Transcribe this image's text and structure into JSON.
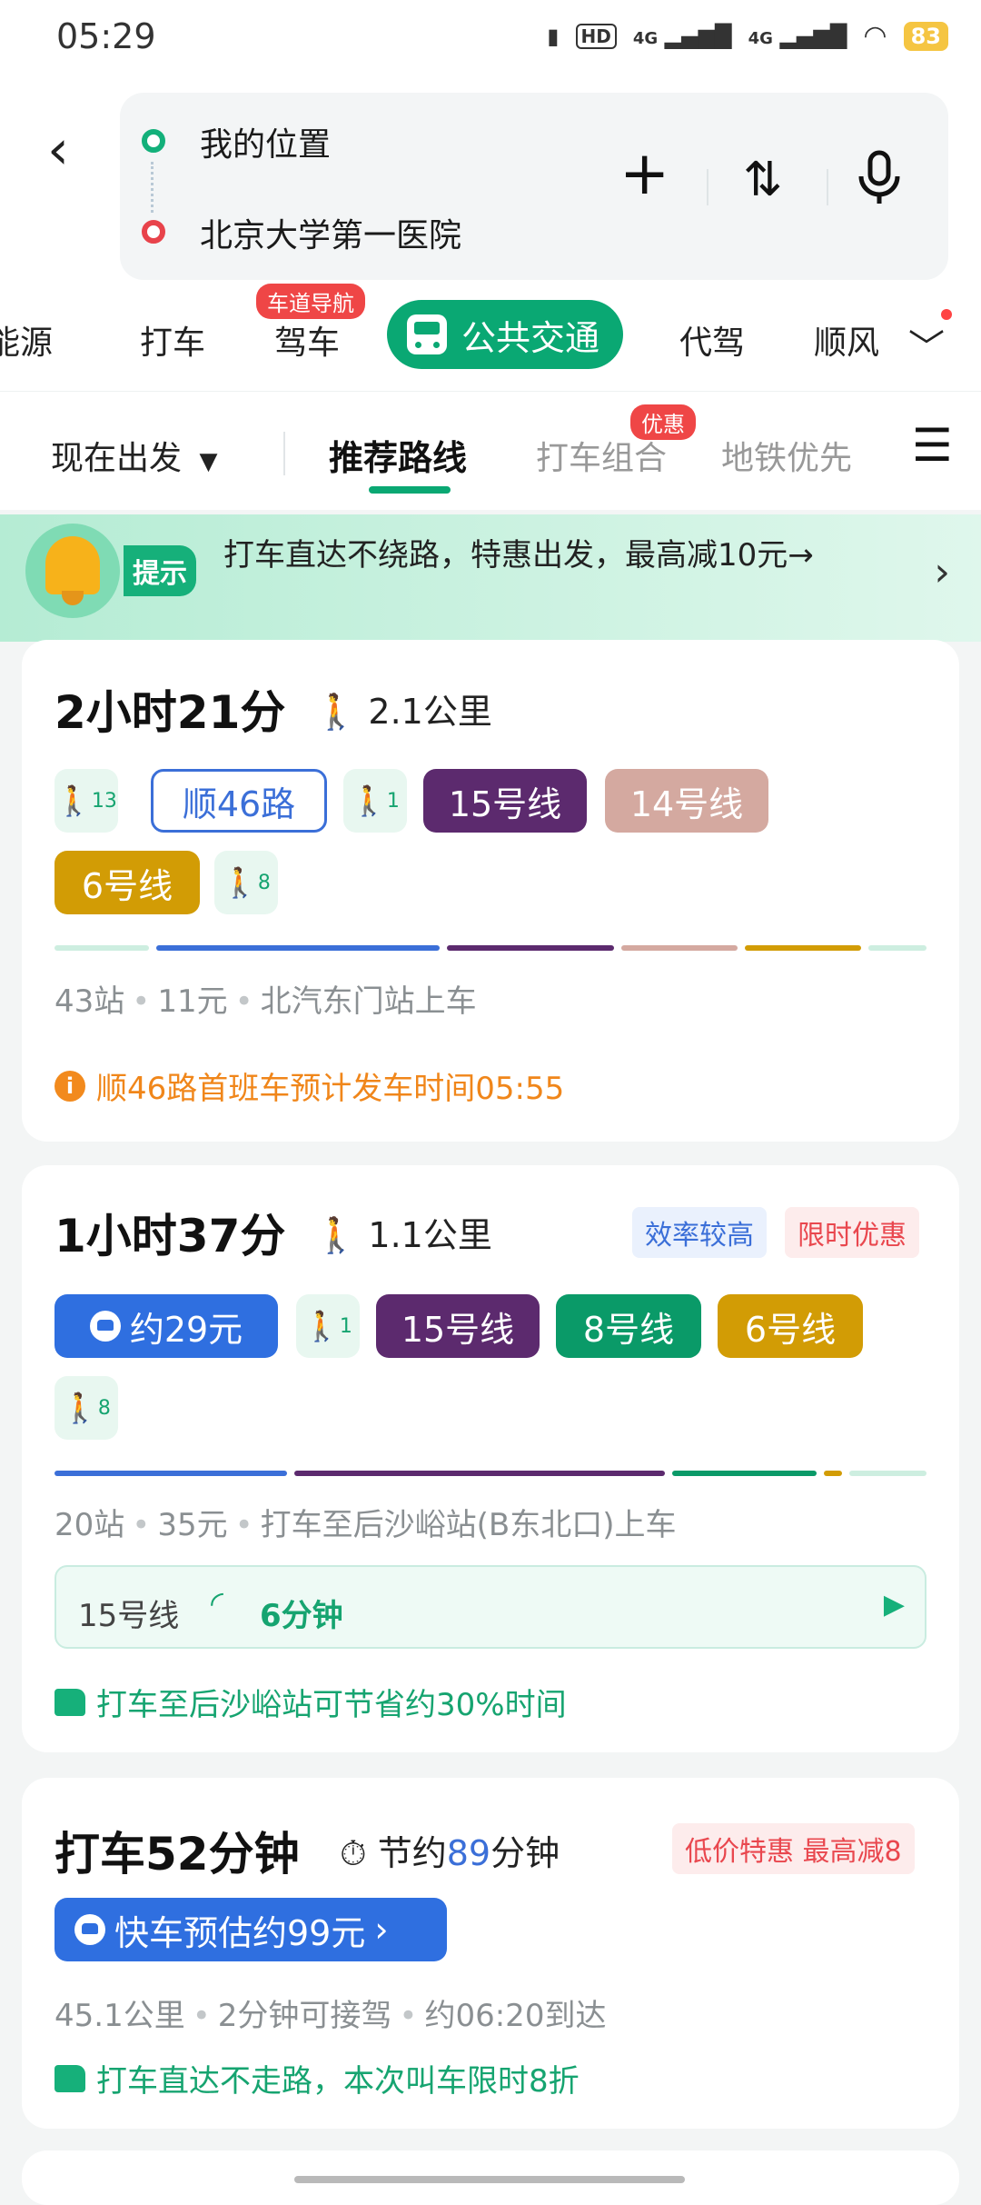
{
  "status": {
    "time": "05:29",
    "battery": "83",
    "net1": "4G",
    "net2": "4G",
    "hd": "HD"
  },
  "search": {
    "origin": "我的位置",
    "destination": "北京大学第一医院"
  },
  "mode_tabs": [
    {
      "label": "能源"
    },
    {
      "label": "打车"
    },
    {
      "label": "驾车",
      "badge": "车道导航"
    },
    {
      "label": "公共交通"
    },
    {
      "label": "代驾"
    },
    {
      "label": "顺风"
    }
  ],
  "sort": {
    "depart": "现在出发",
    "tabs": [
      {
        "label": "推荐路线"
      },
      {
        "label": "打车组合",
        "badge": "优惠"
      },
      {
        "label": "地铁优先"
      }
    ]
  },
  "tip": {
    "label": "提示",
    "text": "打车直达不绕路，特惠出发，最高减10元→"
  },
  "colors": {
    "accent": "#0aa873",
    "line15": "#5c2a6e",
    "line14": "#d4a9a0",
    "line6": "#d29c05",
    "line8": "#0a9a68",
    "bus": "#3b6fd8",
    "taxi": "#2f6fe0"
  },
  "route1": {
    "duration": "2小时21分",
    "walk": "2.1公里",
    "walk_a": "13",
    "bus": "顺46路",
    "walk_b": "1",
    "line_a": "15号线",
    "line_b": "14号线",
    "line_c": "6号线",
    "walk_c": "8",
    "meta": [
      "43站",
      "11元",
      "北汽东门站上车"
    ],
    "notice": "顺46路首班车预计发车时间05:55"
  },
  "route2": {
    "duration": "1小时37分",
    "walk": "1.1公里",
    "tags": [
      "效率较高",
      "限时优惠"
    ],
    "taxi": "约29元",
    "walk_a": "1",
    "line_a": "15号线",
    "line_b": "8号线",
    "line_c": "6号线",
    "walk_b": "8",
    "meta": [
      "20站",
      "35元",
      "打车至后沙峪站(B东北口)上车"
    ],
    "live_line": "15号线",
    "live_time": "6分钟",
    "notice": "打车至后沙峪站可节省约30%时间"
  },
  "route3": {
    "duration": "打车52分钟",
    "save_prefix": "节约",
    "save_num": "89",
    "save_suffix": "分钟",
    "tag": "低价特惠 最高减8",
    "button": "快车预估约99元",
    "meta": [
      "45.1公里",
      "2分钟可接驾",
      "约06:20到达"
    ],
    "notice": "打车直达不走路，本次叫车限时8折"
  }
}
